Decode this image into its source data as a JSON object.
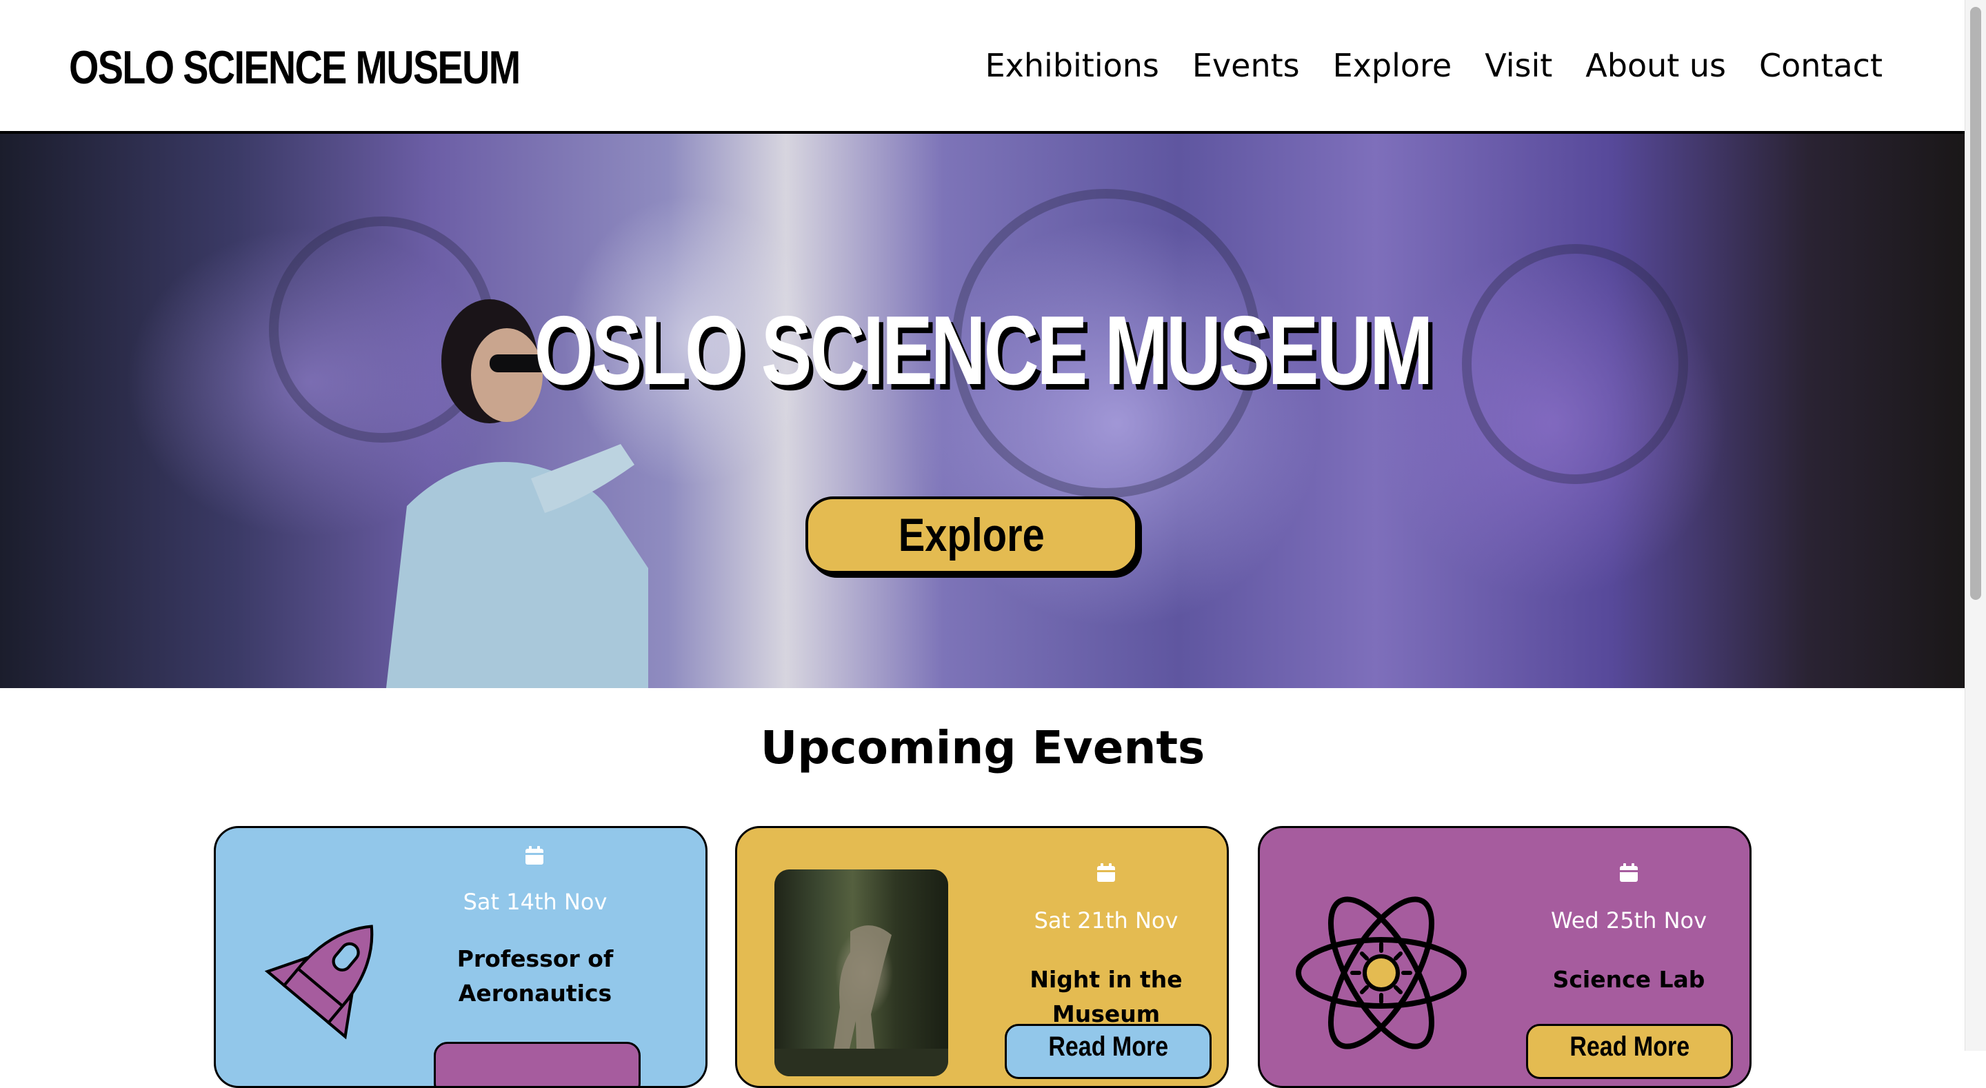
{
  "header": {
    "logo": "OSLO SCIENCE MUSEUM",
    "nav": [
      "Exhibitions",
      "Events",
      "Explore",
      "Visit",
      "About us",
      "Contact"
    ]
  },
  "hero": {
    "title": "OSLO SCIENCE MUSEUM",
    "button_label": "Explore"
  },
  "events": {
    "heading": "Upcoming Events",
    "cards": [
      {
        "date": "Sat 14th Nov",
        "title_line1": "Professor of",
        "title_line2": "Aeronautics",
        "color": "#92c7ea",
        "icon": "rocket-icon",
        "button_color": "#a65c9e"
      },
      {
        "date": "Sat 21th Nov",
        "title_line1": "Night in the Museum",
        "title_line2": "",
        "button_label": "Read More",
        "color": "#e4bb51",
        "icon": "dinosaur-photo",
        "button_color": "#92c7ea"
      },
      {
        "date": "Wed 25th Nov",
        "title_line1": "Science Lab",
        "title_line2": "",
        "button_label": "Read More",
        "color": "#a65c9e",
        "icon": "atom-icon",
        "button_color": "#e4bb51"
      }
    ]
  },
  "colors": {
    "accent_yellow": "#e4bb51",
    "accent_blue": "#92c7ea",
    "accent_purple": "#a65c9e"
  }
}
